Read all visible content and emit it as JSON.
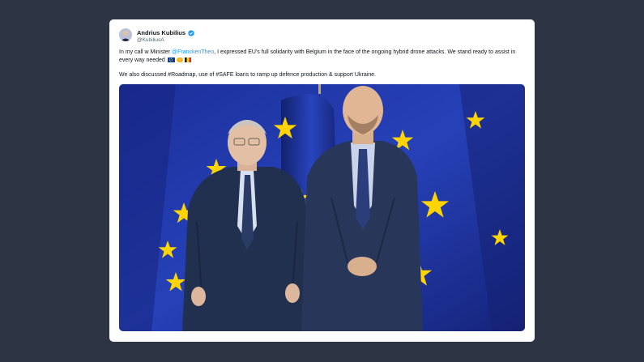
{
  "tweet": {
    "author_name": "Andrius Kubilius",
    "author_handle": "@KubiliusA",
    "text_line1_pre": "In my call w Minister ",
    "mention": "@FranckenTheo",
    "text_line1_post": ", I expressed EU's full solidarity with Belgium in the face of the ongoing hybrid drone attacks. We stand ready to assist in every way needed ",
    "text_line2": "We also discussed #Roadmap, use of #SAFE loans to ramp up defence production & support Ukraine.",
    "emojis": [
      "eu-flag",
      "handshake",
      "belgium-flag"
    ]
  },
  "colors": {
    "page_background": "#2d3544",
    "card_background": "#ffffff",
    "link": "#1d9bf0",
    "verified": "#1d9bf0",
    "eu_blue": "#1a2fa0",
    "eu_star": "#ffd400"
  },
  "icons": {
    "verified": "verified-badge-icon",
    "avatar": "profile-photo"
  },
  "photo": {
    "subject": "two men in dark suits standing in front of EU flags"
  }
}
